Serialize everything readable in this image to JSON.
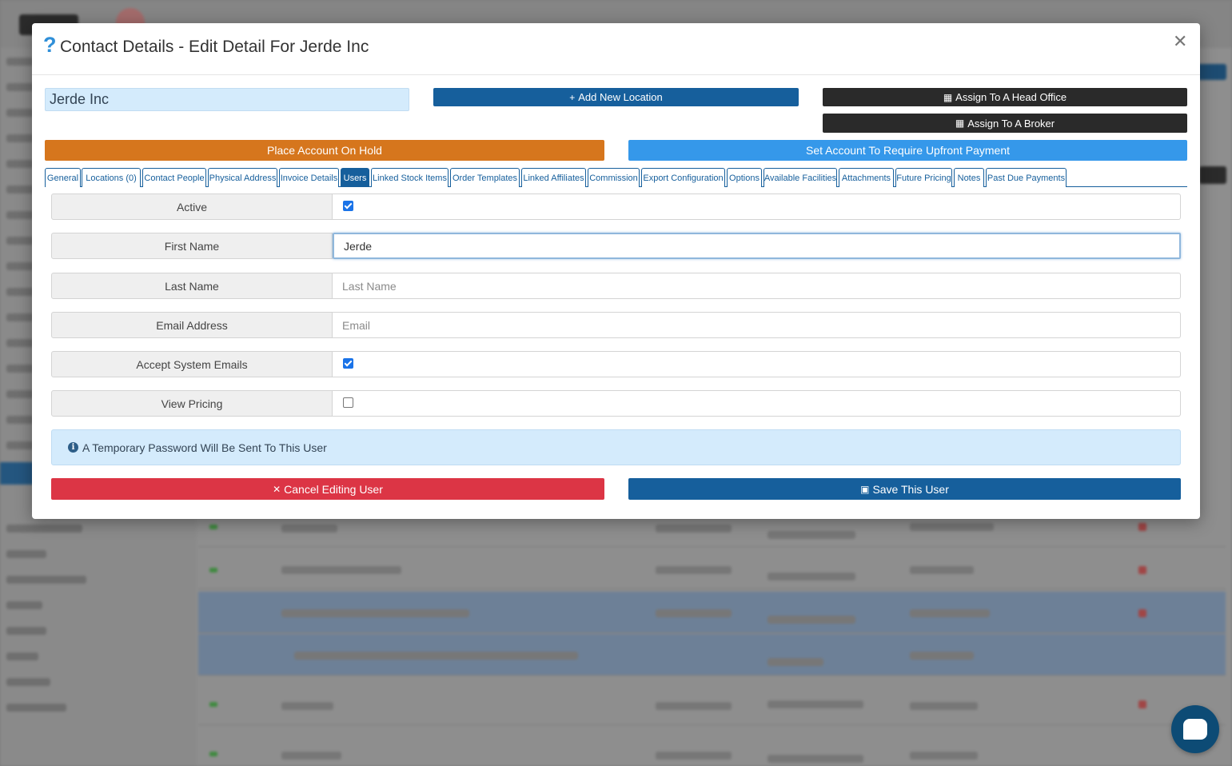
{
  "modal": {
    "title": "Contact Details - Edit Detail For Jerde Inc",
    "company_name": "Jerde Inc"
  },
  "actions": {
    "add_location": "Add New Location",
    "assign_head_office": "Assign To A Head Office",
    "assign_broker": "Assign To A Broker",
    "place_on_hold": "Place Account On Hold",
    "require_upfront": "Set Account To Require Upfront Payment"
  },
  "tabs": [
    "General",
    "Locations (0)",
    "Contact People",
    "Physical Address",
    "Invoice Details",
    "Users",
    "Linked Stock Items",
    "Order Templates",
    "Linked Affiliates",
    "Commission",
    "Export Configuration",
    "Options",
    "Available Facilities",
    "Attachments",
    "Future Pricing",
    "Notes",
    "Past Due Payments"
  ],
  "active_tab": "Users",
  "form": {
    "active": {
      "label": "Active",
      "checked": true
    },
    "first_name": {
      "label": "First Name",
      "value": "Jerde",
      "placeholder": "First Name"
    },
    "last_name": {
      "label": "Last Name",
      "value": "",
      "placeholder": "Last Name"
    },
    "email": {
      "label": "Email Address",
      "value": "",
      "placeholder": "Email"
    },
    "accept_emails": {
      "label": "Accept System Emails",
      "checked": true
    },
    "view_pricing": {
      "label": "View Pricing",
      "checked": false
    }
  },
  "info": {
    "message": "A Temporary Password Will Be Sent To This User"
  },
  "footer": {
    "cancel_label": "Cancel Editing User",
    "save_label": "Save This User"
  },
  "colors": {
    "primary": "#165f9c",
    "dark": "#2a2a2a",
    "warning": "#d6761d",
    "info": "#3598ea",
    "danger": "#dc3545"
  }
}
